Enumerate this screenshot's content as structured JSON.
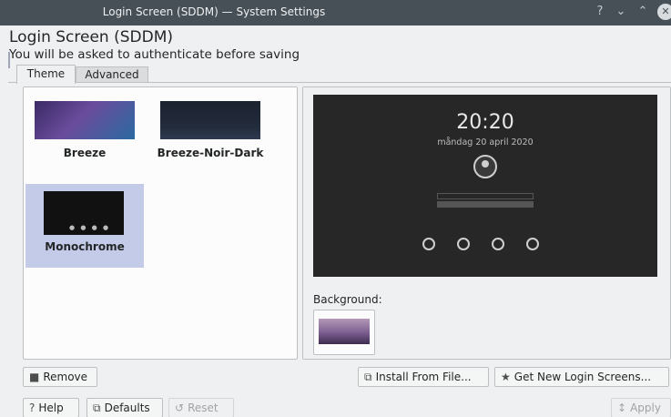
{
  "window": {
    "title": "Login Screen (SDDM) — System Settings",
    "controls": {
      "help": "?",
      "minimize": "⌄",
      "maximize": "⌃",
      "close": "✕"
    }
  },
  "header": {
    "title": "Login Screen (SDDM)",
    "subtitle": "You will be asked to authenticate before saving"
  },
  "tabs": [
    {
      "label": "Theme",
      "active": true
    },
    {
      "label": "Advanced",
      "active": false
    }
  ],
  "themes": [
    {
      "name": "Breeze",
      "selected": false
    },
    {
      "name": "Breeze-Noir-Dark",
      "selected": false
    },
    {
      "name": "Monochrome",
      "selected": true
    }
  ],
  "preview": {
    "time": "20:20",
    "date": "måndag 20 april 2020"
  },
  "background": {
    "label": "Background:"
  },
  "buttons": {
    "remove": "Remove",
    "install_from_file": "Install From File...",
    "get_new": "Get New Login Screens...",
    "help": "Help",
    "defaults": "Defaults",
    "reset": "Reset",
    "apply": "Apply"
  },
  "colors": {
    "titlebar": "#475057",
    "selection": "#c3cbe8",
    "window_bg": "#eff0f1"
  }
}
